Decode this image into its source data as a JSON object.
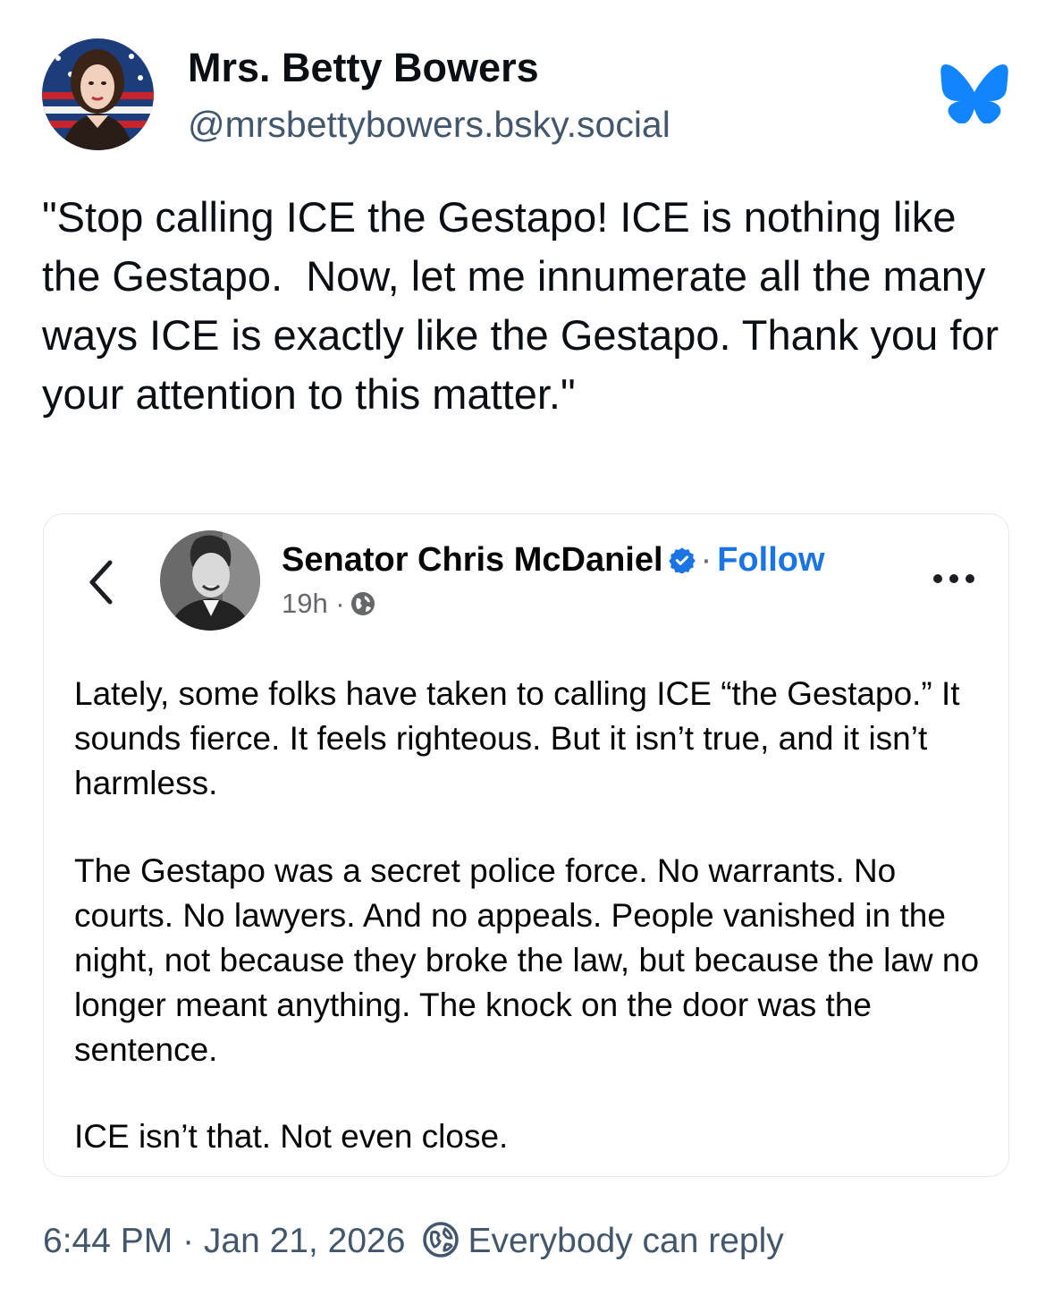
{
  "author": {
    "display_name": "Mrs. Betty Bowers",
    "handle": "@mrsbettybowers.bsky.social",
    "avatar_icon": "avatar-woman-flag-background"
  },
  "app_logo_icon": "bluesky-butterfly-icon",
  "colors": {
    "bluesky_blue": "#1185fe",
    "facebook_blue": "#1b74e4",
    "muted_text": "#42576c"
  },
  "post": {
    "text": "\"Stop calling ICE the Gestapo! ICE is nothing like the Gestapo.  Now, let me innumerate all the many ways ICE is exactly like the Gestapo. Thank you for your attention to this matter.\""
  },
  "embed": {
    "name": "Senator Chris McDaniel",
    "follow_sep": "·",
    "follow_label": "Follow",
    "time": "19h ·",
    "paragraphs": [
      "Lately, some folks have taken to calling ICE “the Gestapo.”  It sounds fierce.  It feels righteous.  But it isn’t true, and it isn’t harmless.",
      "The Gestapo was a secret police force.  No warrants.  No courts.  No lawyers.  And no appeals.  People vanished in the night, not because they broke the law, but because the law no longer meant anything.  The knock on the door was the sentence.",
      "ICE isn’t that.  Not even close."
    ]
  },
  "footer": {
    "timestamp": "6:44 PM · Jan 21, 2026",
    "reply_setting": "Everybody can reply"
  }
}
